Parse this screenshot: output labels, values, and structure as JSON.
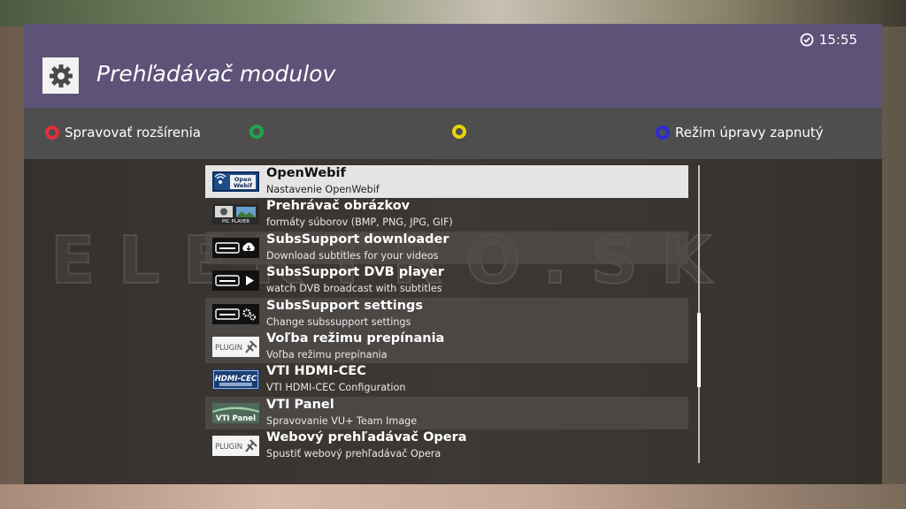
{
  "window": {
    "title": "Prehľadávač modulov",
    "clock": "15:55"
  },
  "colorbar": {
    "red_label": "Spravovať rozšírenia",
    "green_label": "",
    "yellow_label": "",
    "blue_label": "Režim úpravy zapnutý",
    "colors": {
      "red": "#e0303a",
      "green": "#1fa64a",
      "yellow": "#e8d60a",
      "blue": "#2c2bd0"
    }
  },
  "watermark": "ELEKTRO.SK",
  "list": {
    "selected_index": 0,
    "items": [
      {
        "title": "OpenWebif",
        "desc": "Nastavenie OpenWebif",
        "icon": "openwebif-icon"
      },
      {
        "title": "Prehrávač obrázkov",
        "desc": "formáty súborov (BMP, PNG, JPG, GIF)",
        "icon": "pic-player-icon",
        "icon_text": "PIC PLAYER"
      },
      {
        "title": "SubsSupport downloader",
        "desc": "Download subtitles for your videos",
        "icon": "cloud-download-icon"
      },
      {
        "title": "SubsSupport DVB player",
        "desc": "watch DVB broadcast with subtitles",
        "icon": "play-icon"
      },
      {
        "title": "SubsSupport settings",
        "desc": "Change subssupport settings",
        "icon": "gears-icon"
      },
      {
        "title": "Voľba režimu prepínania",
        "desc": "Voľba režimu prepínania",
        "icon": "plugin-icon",
        "icon_text": "PLUGIN"
      },
      {
        "title": "VTI HDMI-CEC",
        "desc": "VTI HDMI-CEC Configuration",
        "icon": "hdmi-cec-icon",
        "icon_text": "HDMI-CEC"
      },
      {
        "title": "VTI Panel",
        "desc": "Spravovanie VU+ Team Image",
        "icon": "vti-panel-icon",
        "icon_text": "VTI Panel"
      },
      {
        "title": "Webový prehľadávač Opera",
        "desc": "Spustiť webový prehľadávač Opera",
        "icon": "plugin-icon",
        "icon_text": "PLUGIN"
      }
    ]
  }
}
